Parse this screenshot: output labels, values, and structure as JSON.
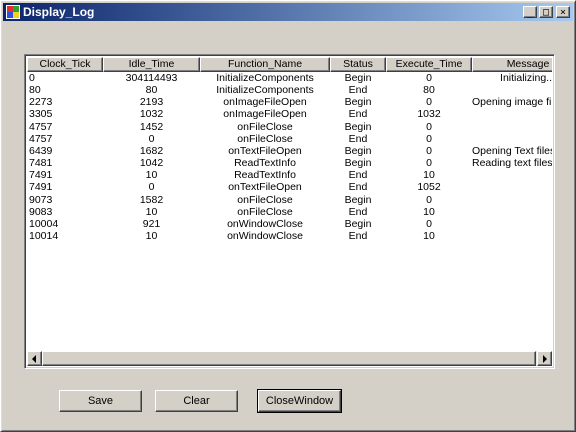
{
  "window": {
    "title": "Display_Log"
  },
  "caption_buttons": {
    "minimize": "_",
    "maximize": "□",
    "close": "×"
  },
  "columns": [
    "Clock_Tick",
    "Idle_Time",
    "Function_Name",
    "Status",
    "Execute_Time",
    "Message"
  ],
  "rows": [
    [
      "0",
      "304114493",
      "InitializeComponents",
      "Begin",
      "0",
      "Initializing.."
    ],
    [
      "80",
      "80",
      "InitializeComponents",
      "End",
      "80",
      ""
    ],
    [
      "2273",
      "2193",
      "onImageFileOpen",
      "Begin",
      "0",
      "Opening image files"
    ],
    [
      "3305",
      "1032",
      "onImageFileOpen",
      "End",
      "1032",
      ""
    ],
    [
      "4757",
      "1452",
      "onFileClose",
      "Begin",
      "0",
      ""
    ],
    [
      "4757",
      "0",
      "onFileClose",
      "End",
      "0",
      ""
    ],
    [
      "6439",
      "1682",
      "onTextFileOpen",
      "Begin",
      "0",
      "Opening Text files"
    ],
    [
      "7481",
      "1042",
      "ReadTextInfo",
      "Begin",
      "0",
      "Reading text files"
    ],
    [
      "7491",
      "10",
      "ReadTextInfo",
      "End",
      "10",
      ""
    ],
    [
      "7491",
      "0",
      "onTextFileOpen",
      "End",
      "1052",
      ""
    ],
    [
      "9073",
      "1582",
      "onFileClose",
      "Begin",
      "0",
      ""
    ],
    [
      "9083",
      "10",
      "onFileClose",
      "End",
      "10",
      ""
    ],
    [
      "10004",
      "921",
      "onWindowClose",
      "Begin",
      "0",
      ""
    ],
    [
      "10014",
      "10",
      "onWindowClose",
      "End",
      "10",
      ""
    ]
  ],
  "buttons": {
    "save": "Save",
    "clear": "Clear",
    "close_window": "CloseWindow"
  }
}
